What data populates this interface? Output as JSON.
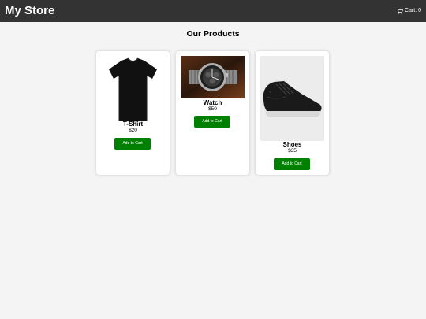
{
  "header": {
    "brand": "My Store",
    "cart_label": "Cart: 0",
    "cart_icon": "shopping-cart-icon"
  },
  "main": {
    "title": "Our Products"
  },
  "products": [
    {
      "name": "T-Shirt",
      "price": "$20",
      "button_label": "Add to Cart",
      "image": "tshirt-image"
    },
    {
      "name": "Watch",
      "price": "$50",
      "button_label": "Add to Cart",
      "image": "watch-image"
    },
    {
      "name": "Shoes",
      "price": "$35",
      "button_label": "Add to Cart",
      "image": "shoes-image"
    }
  ],
  "colors": {
    "header_bg": "#333333",
    "page_bg": "#f4f4f4",
    "button_bg": "#008000",
    "button_text": "#ffffff"
  }
}
